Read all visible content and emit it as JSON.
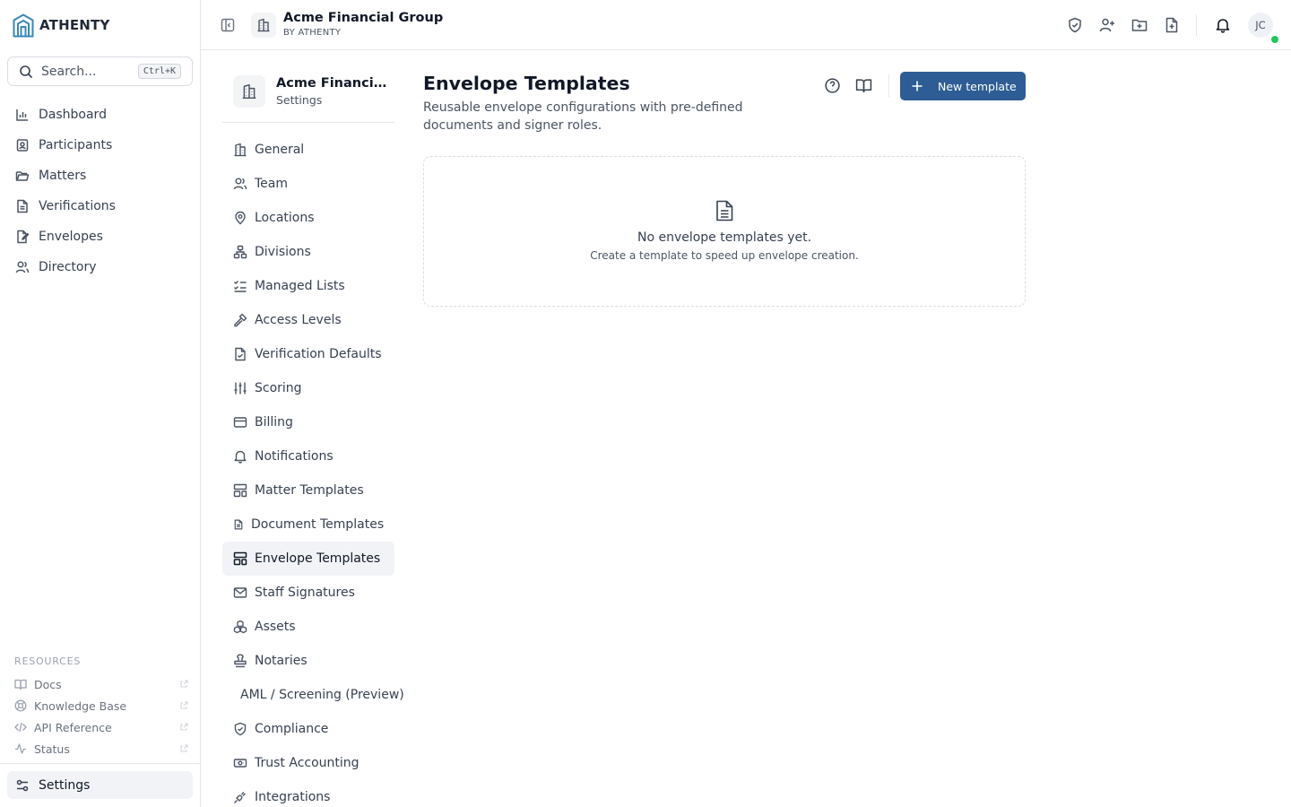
{
  "brand": {
    "name": "ATHENTY"
  },
  "search": {
    "placeholder": "Search...",
    "shortcut": "Ctrl+K"
  },
  "nav": {
    "items": [
      {
        "label": "Dashboard",
        "icon": "bar-chart-icon"
      },
      {
        "label": "Participants",
        "icon": "id-card-icon"
      },
      {
        "label": "Matters",
        "icon": "folder-icon"
      },
      {
        "label": "Verifications",
        "icon": "document-icon"
      },
      {
        "label": "Envelopes",
        "icon": "file-signature-icon"
      },
      {
        "label": "Directory",
        "icon": "users-icon"
      }
    ]
  },
  "resources": {
    "title": "RESOURCES",
    "items": [
      {
        "label": "Docs",
        "icon": "book-icon"
      },
      {
        "label": "Knowledge Base",
        "icon": "lifebuoy-icon"
      },
      {
        "label": "API Reference",
        "icon": "code-icon"
      },
      {
        "label": "Status",
        "icon": "activity-icon"
      }
    ]
  },
  "settings_link": {
    "label": "Settings"
  },
  "topbar": {
    "org_name": "Acme Financial Group",
    "org_sub": "BY ATHENTY",
    "avatar_initials": "JC",
    "status_color": "#22c55e"
  },
  "subnav": {
    "org_name": "Acme Financial Group",
    "org_sub": "Settings",
    "items": [
      {
        "label": "General",
        "icon": "building-icon"
      },
      {
        "label": "Team",
        "icon": "users-icon"
      },
      {
        "label": "Locations",
        "icon": "map-pin-icon"
      },
      {
        "label": "Divisions",
        "icon": "network-icon"
      },
      {
        "label": "Managed Lists",
        "icon": "list-checks-icon"
      },
      {
        "label": "Access Levels",
        "icon": "key-icon"
      },
      {
        "label": "Verification Defaults",
        "icon": "file-check-icon"
      },
      {
        "label": "Scoring",
        "icon": "sliders-icon"
      },
      {
        "label": "Billing",
        "icon": "credit-card-icon"
      },
      {
        "label": "Notifications",
        "icon": "bell-icon"
      },
      {
        "label": "Matter Templates",
        "icon": "layout-template-icon"
      },
      {
        "label": "Document Templates",
        "icon": "file-text-icon"
      },
      {
        "label": "Envelope Templates",
        "icon": "layout-template-icon",
        "active": true
      },
      {
        "label": "Staff Signatures",
        "icon": "mail-icon"
      },
      {
        "label": "Assets",
        "icon": "boxes-icon"
      },
      {
        "label": "Notaries",
        "icon": "stamp-icon"
      },
      {
        "label": "AML / Screening (Preview)",
        "icon": ""
      },
      {
        "label": "Compliance",
        "icon": "shield-check-icon"
      },
      {
        "label": "Trust Accounting",
        "icon": "banknote-icon"
      },
      {
        "label": "Integrations",
        "icon": "plug-icon"
      }
    ]
  },
  "main": {
    "title": "Envelope Templates",
    "description": "Reusable envelope configurations with pre-defined documents and signer roles.",
    "new_button": "New template",
    "accent": "#2d5d94",
    "empty": {
      "title": "No envelope templates yet.",
      "subtitle": "Create a template to speed up envelope creation."
    }
  }
}
